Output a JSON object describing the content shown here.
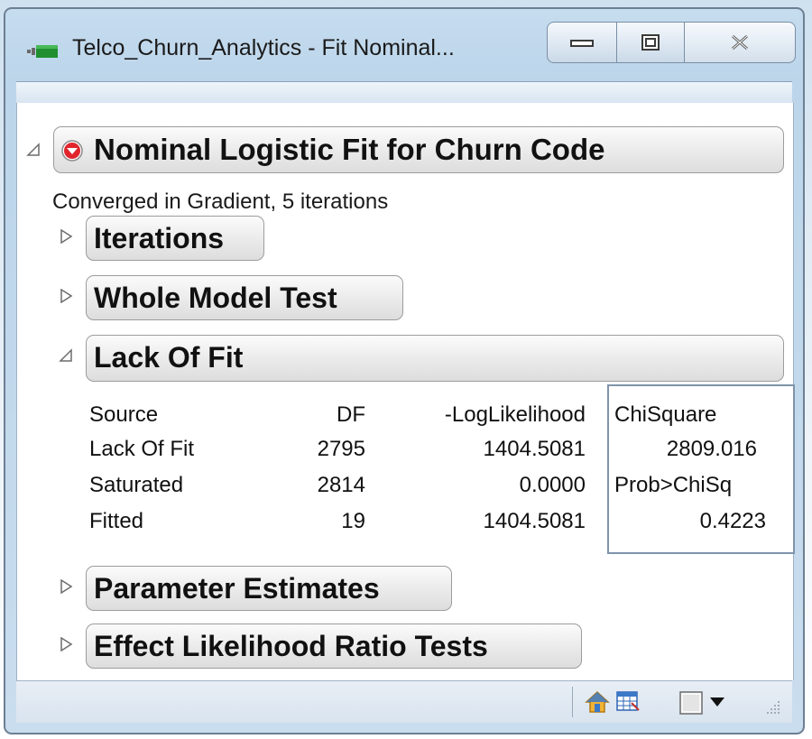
{
  "window": {
    "title": "Telco_Churn_Analytics - Fit Nominal...",
    "controls": {
      "minimize": "minimize",
      "maximize": "maximize",
      "close": "close"
    }
  },
  "report": {
    "title": "Nominal Logistic Fit for Churn Code",
    "convergence": "Converged in Gradient, 5 iterations",
    "sections": {
      "iterations": "Iterations",
      "whole_model": "Whole Model Test",
      "lack_of_fit": "Lack Of Fit",
      "parameter_estimates": "Parameter Estimates",
      "effect_lr": "Effect Likelihood Ratio Tests"
    },
    "lack_of_fit_table": {
      "headers": {
        "source": "Source",
        "df": "DF",
        "loglik": "-LogLikelihood",
        "chisq": "ChiSquare",
        "prob": "Prob>ChiSq"
      },
      "rows": [
        {
          "source": "Lack Of Fit",
          "df": "2795",
          "loglik": "1404.5081"
        },
        {
          "source": "Saturated",
          "df": "2814",
          "loglik": "0.0000"
        },
        {
          "source": "Fitted",
          "df": "19",
          "loglik": "1404.5081"
        }
      ],
      "chisq_value": "2809.016",
      "prob_value": "0.4223"
    }
  },
  "statusbar": {
    "icons": [
      "home-icon",
      "table-grid-icon",
      "checkbox-icon",
      "dropdown-arrow-icon",
      "resize-grip-icon"
    ]
  }
}
